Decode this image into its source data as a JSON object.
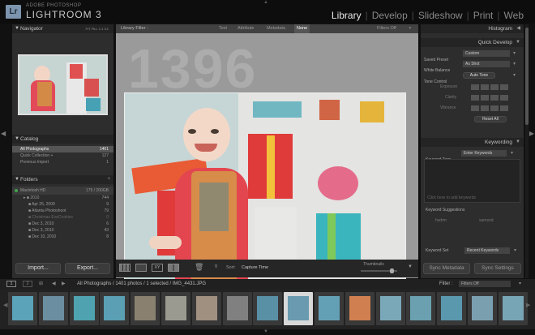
{
  "app": {
    "logo": "Lr",
    "brand_top": "ADOBE PHOTOSHOP",
    "brand_name": "LIGHTROOM 3"
  },
  "modules": [
    "Library",
    "Develop",
    "Slideshow",
    "Print",
    "Web"
  ],
  "active_module": "Library",
  "navigator": {
    "title": "Navigator",
    "zoom": [
      "FIT",
      "FILL",
      "1:1",
      "3:1"
    ]
  },
  "catalog": {
    "title": "Catalog",
    "items": [
      {
        "label": "All Photographs",
        "count": "1401"
      },
      {
        "label": "Quick Collection +",
        "count": "127"
      },
      {
        "label": "Previous Import",
        "count": "1"
      }
    ]
  },
  "folders": {
    "title": "Folders",
    "add": "+",
    "drive": {
      "label": "Macintosh HD",
      "info": "175 / 200GB"
    },
    "items": [
      {
        "label": "2010",
        "count": "744"
      },
      {
        "label": "Apr 25, 2009",
        "count": "9"
      },
      {
        "label": "Atlanta Photoshoot",
        "count": "79"
      },
      {
        "label": "Christmas EveCookies",
        "count": "0"
      },
      {
        "label": "Dec 3, 2010",
        "count": "6"
      },
      {
        "label": "Dec 3, 2010",
        "count": "43"
      },
      {
        "label": "Dec 10, 2010",
        "count": "8"
      }
    ]
  },
  "left_buttons": {
    "import": "Import...",
    "export": "Export..."
  },
  "filter": {
    "label": "Library Filter :",
    "tabs": [
      "Text",
      "Attribute",
      "Metadata",
      "None"
    ],
    "active": "None",
    "filters_off": "Filters Off"
  },
  "loupe": {
    "watermark": "1396"
  },
  "toolbar": {
    "sort_label": "Sort:",
    "sort_value": "Capture Time",
    "thumbnails": "Thumbnails"
  },
  "histogram": {
    "title": "Histogram"
  },
  "quick_develop": {
    "title": "Quick Develop",
    "saved_preset_label": "Saved Preset",
    "saved_preset": "Custom",
    "white_balance_label": "White Balance",
    "white_balance": "As Shot",
    "tone_control_label": "Tone Control",
    "auto_tone": "Auto Tone",
    "exposure": "Exposure",
    "clarity": "Clarity",
    "vibrance": "Vibrance",
    "reset": "Reset All"
  },
  "keywording": {
    "title": "Keywording",
    "tags_label": "Keyword Tags",
    "tags_value": "Enter Keywords",
    "placeholder": "Click here to add keywords",
    "suggestions_title": "Keyword Suggestions",
    "suggestions": [
      "hvdrm",
      "samsnd"
    ],
    "set_label": "Keyword Set",
    "set_value": "Recent Keywords"
  },
  "right_buttons": {
    "sync_metadata": "Sync Metadata",
    "sync_settings": "Sync Settings"
  },
  "filmbar": {
    "page1": "1",
    "page2": "2",
    "path": "All Photographs / 1401 photos / 1 selected / IMG_4431.JPG",
    "filter_label": "Filter :",
    "filter_value": "Filters Off"
  },
  "thumb_colors": [
    "#5ba3b8",
    "#6b8ea0",
    "#4fa3b0",
    "#5a9fb3",
    "#8a8070",
    "#9a9a90",
    "#a09080",
    "#808080",
    "#5a90a5",
    "#6a9ab0",
    "#64a0b5",
    "#d08050",
    "#7aa8b8",
    "#6aa0b0",
    "#5a98ae",
    "#7aa0b0",
    "#78a5b5"
  ],
  "selected_thumb": 9
}
